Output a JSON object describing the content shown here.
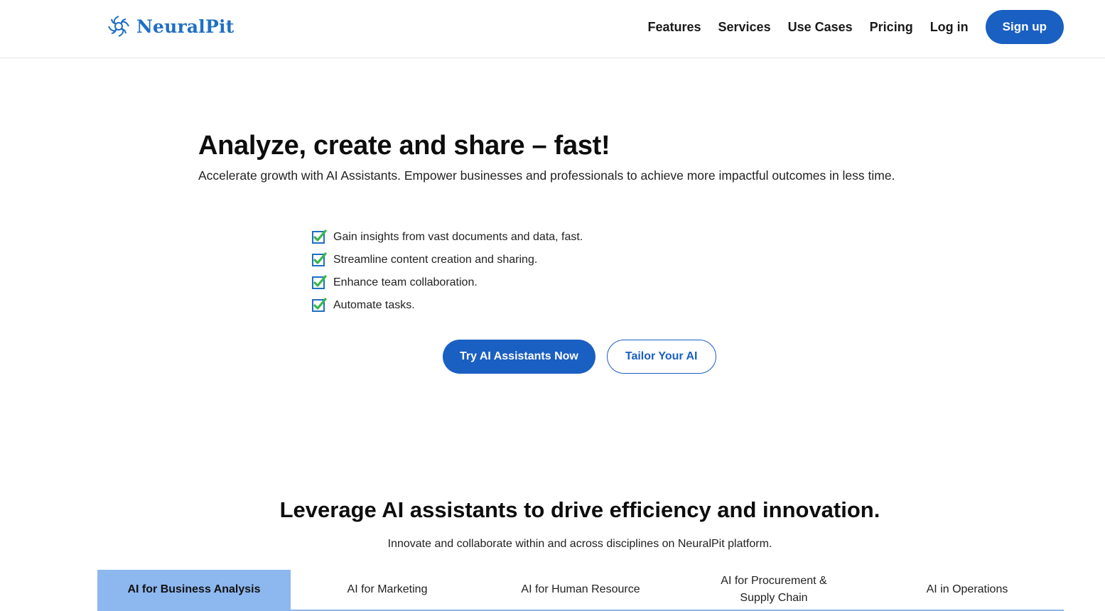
{
  "brand": {
    "name": "NeuralPit",
    "color": "#1f6fc4"
  },
  "nav": {
    "links": [
      "Features",
      "Services",
      "Use Cases",
      "Pricing",
      "Log in"
    ],
    "signup": "Sign up"
  },
  "hero": {
    "title": "Analyze, create and share – fast!",
    "subtitle": "Accelerate growth with AI Assistants. Empower businesses and professionals to achieve more impactful outcomes in less time.",
    "features": [
      "Gain insights from vast documents and data, fast.",
      "Streamline content creation and sharing.",
      "Enhance team collaboration.",
      "Automate tasks."
    ],
    "primary_cta": "Try AI Assistants Now",
    "secondary_cta": "Tailor Your AI"
  },
  "section": {
    "title": "Leverage AI assistants to drive efficiency and innovation.",
    "subtitle": "Innovate and collaborate within and across disciplines on NeuralPit platform."
  },
  "tabs": [
    {
      "label": "AI for Business Analysis",
      "active": true
    },
    {
      "label": "AI for Marketing",
      "active": false
    },
    {
      "label": "AI for Human Resource",
      "active": false
    },
    {
      "label": "AI for Procurement & Supply Chain",
      "active": false
    },
    {
      "label": "AI in Operations",
      "active": false
    }
  ],
  "icons": {
    "logo": "neural-swirl-icon",
    "feature": "green-checkbox-icon"
  },
  "colors": {
    "accent": "#1a5fc2",
    "tab_active": "#8db7ef",
    "check": "#35b84a"
  }
}
